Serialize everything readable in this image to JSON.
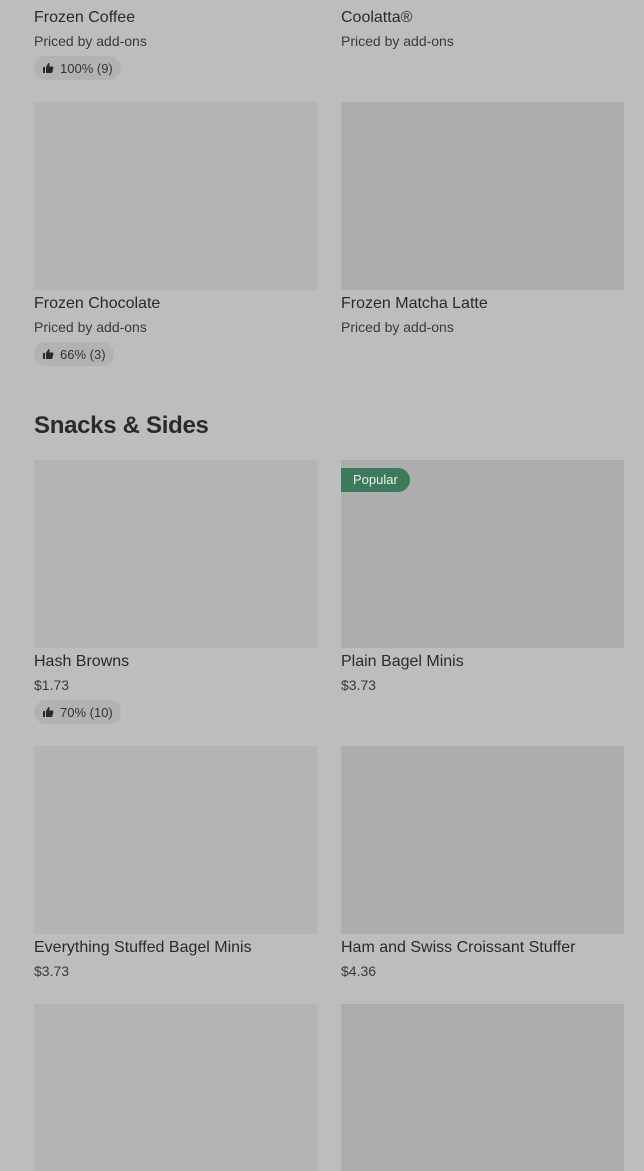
{
  "top_items": [
    {
      "name": "Frozen Coffee",
      "price": "Priced by add-ons",
      "rating": "100% (9)"
    },
    {
      "name": "Coolatta®",
      "price": "Priced by add-ons",
      "rating": null
    }
  ],
  "items_row2": [
    {
      "name": "Frozen Chocolate",
      "price": "Priced by add-ons",
      "rating": "66% (3)"
    },
    {
      "name": "Frozen Matcha Latte",
      "price": "Priced by add-ons",
      "rating": null
    }
  ],
  "snacks_section": {
    "title": "Snacks & Sides",
    "badge_popular": "Popular",
    "row1": [
      {
        "name": "Hash Browns",
        "price": "$1.73",
        "rating": "70% (10)"
      },
      {
        "name": "Plain Bagel Minis",
        "price": "$3.73",
        "rating": null
      }
    ],
    "row2": [
      {
        "name": "Everything Stuffed Bagel Minis",
        "price": "$3.73",
        "rating": null
      },
      {
        "name": "Ham and Swiss Croissant Stuffer",
        "price": "$4.36",
        "rating": null
      }
    ]
  },
  "colors": {
    "background": "#bdbdbd",
    "thumbnail": "#b4b4b4",
    "popular_badge": "#3d7a5c"
  },
  "icons": {
    "rating": "thumbs-up-icon"
  }
}
